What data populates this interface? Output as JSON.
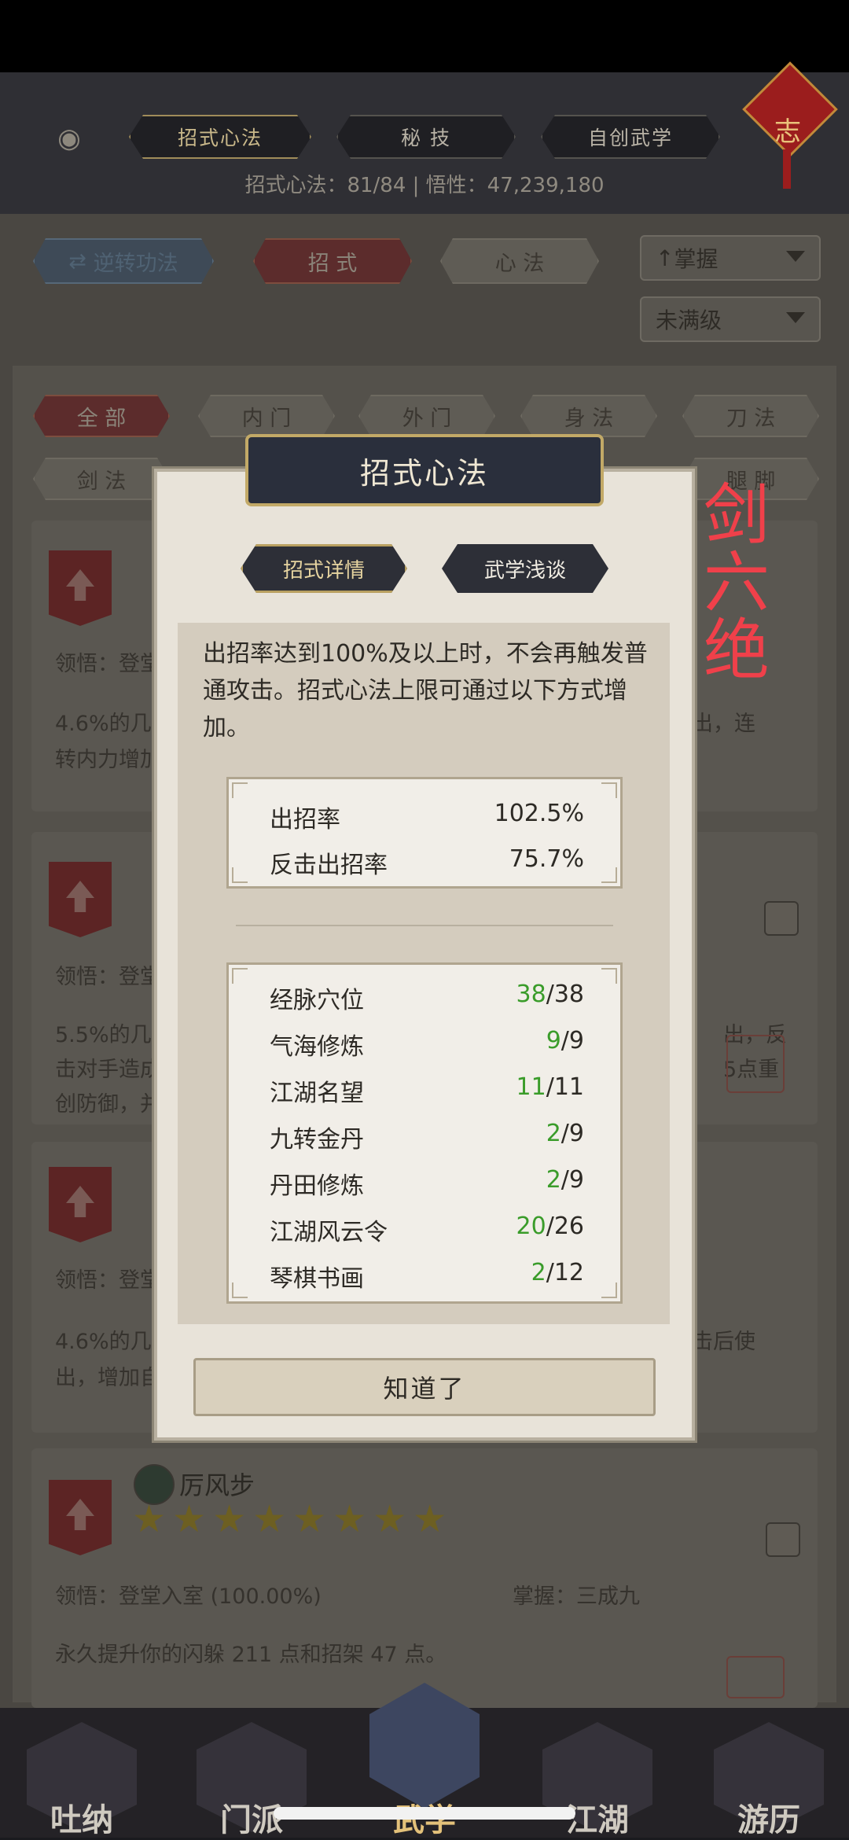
{
  "header": {
    "tabs": [
      "招式心法",
      "秘 技",
      "自创武学"
    ],
    "stats": "招式心法：81/84  |  悟性：47,239,180",
    "charm_char": "志"
  },
  "filters": {
    "reverse_label": "逆转功法",
    "type_tabs": [
      "招 式",
      "心 法"
    ],
    "sort_dropdown": "掌握",
    "level_dropdown": "未满级",
    "categories_row1": [
      "全 部",
      "内 门",
      "外 门",
      "身 法",
      "刀 法"
    ],
    "categories_row2": [
      "剑 法",
      "腿 脚"
    ]
  },
  "cards": [
    {
      "title": "",
      "comprehension": "领悟：登堂",
      "desc": "4.6%的几率…转内力增加…",
      "desc_lines": [
        "4.6%的几",
        "转内力增加"
      ],
      "right_text": "出，连"
    },
    {
      "title": "",
      "comprehension": "领悟：登堂",
      "desc_lines": [
        "5.5%的几",
        "击对手造成",
        "创防御，并"
      ],
      "right_lines": [
        "出，反",
        "5点重"
      ]
    },
    {
      "title": "",
      "comprehension": "领悟：登堂",
      "desc_lines": [
        "4.6%的几",
        "出，增加自"
      ],
      "right_lines": [
        "击后使"
      ]
    },
    {
      "title": "厉风步",
      "comprehension": "领悟：登堂入室 (100.00%)",
      "mastery": "掌握：三成九",
      "desc_lines": [
        "永久提升你的闪躲 211 点和招架 47 点。"
      ]
    }
  ],
  "modal": {
    "title": "招式心法",
    "tabs": [
      "招式详情",
      "武学浅谈"
    ],
    "description": "出招率达到100%及以上时，不会再触发普通攻击。招式心法上限可通过以下方式增加。",
    "rates": [
      {
        "label": "出招率",
        "value": "102.5%"
      },
      {
        "label": "反击出招率",
        "value": "75.7%"
      }
    ],
    "sources": [
      {
        "label": "经脉穴位",
        "current": "38",
        "max": "/38"
      },
      {
        "label": "气海修炼",
        "current": "9",
        "max": "/9"
      },
      {
        "label": "江湖名望",
        "current": "11",
        "max": "/11"
      },
      {
        "label": "九转金丹",
        "current": "2",
        "max": "/9"
      },
      {
        "label": "丹田修炼",
        "current": "2",
        "max": "/9"
      },
      {
        "label": "江湖风云令",
        "current": "20",
        "max": "/26"
      },
      {
        "label": "琴棋书画",
        "current": "2",
        "max": "/12"
      }
    ],
    "ok_label": "知道了"
  },
  "overlay_text": [
    "剑",
    "六",
    "绝"
  ],
  "nav": [
    "吐纳",
    "门派",
    "武学",
    "江湖",
    "游历"
  ],
  "colors": {
    "accent_green": "#3a9c2a",
    "overlay_red": "#f0404a",
    "modal_gold": "#c2a967"
  }
}
